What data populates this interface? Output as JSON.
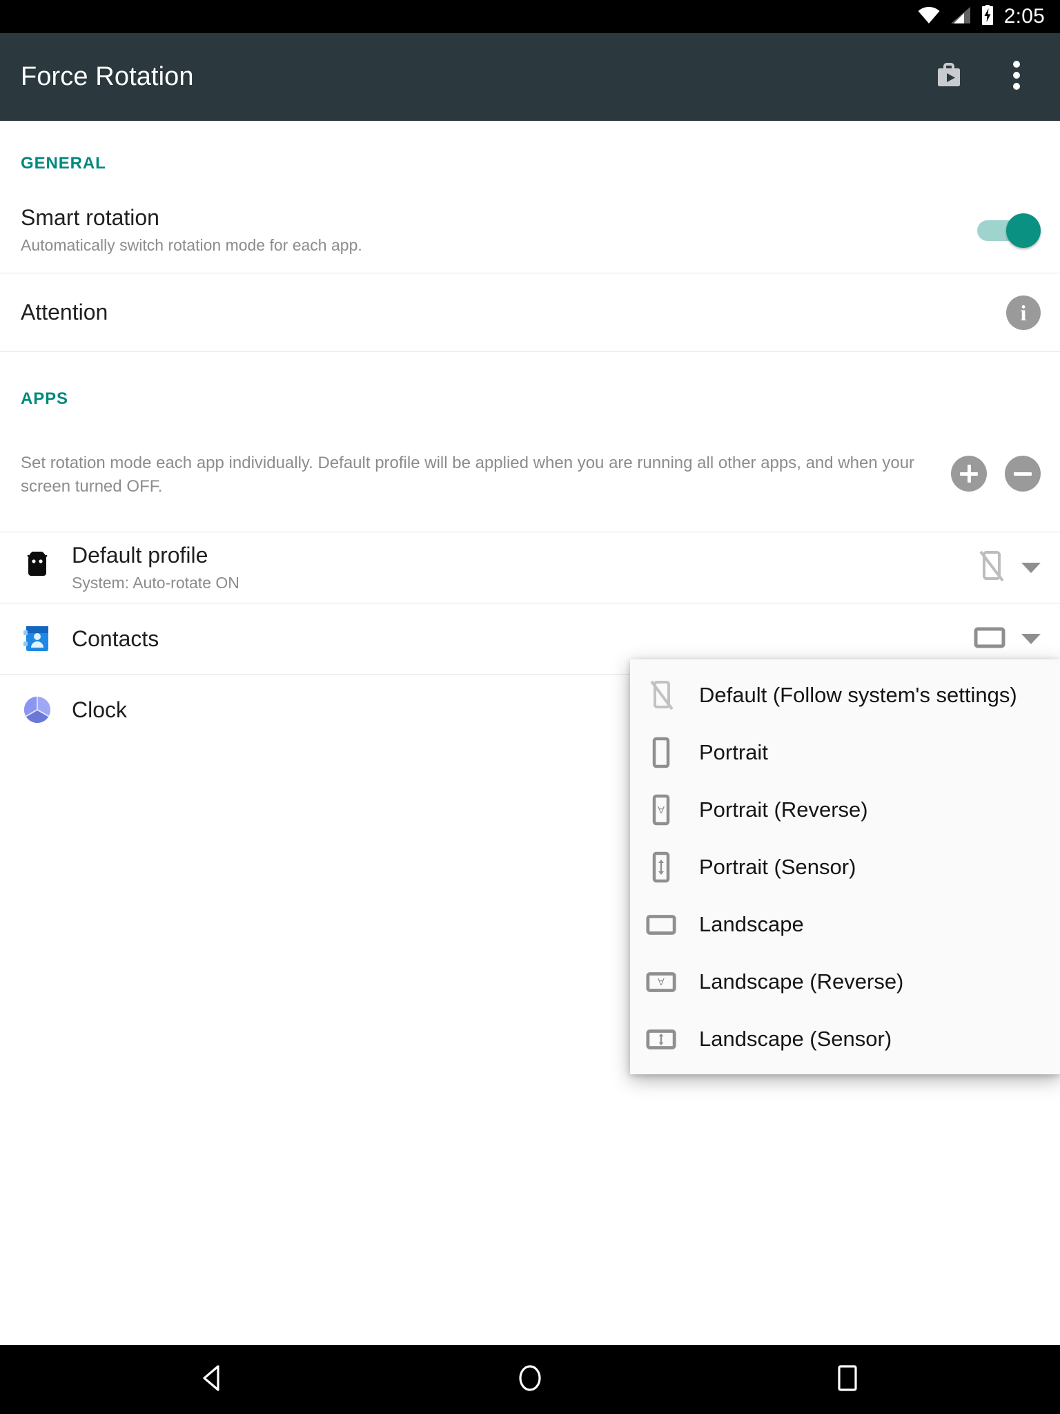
{
  "status_bar": {
    "time": "2:05",
    "icons": [
      "wifi-icon",
      "cell-signal-icon",
      "battery-charging-icon"
    ]
  },
  "app_bar": {
    "title": "Force Rotation",
    "actions": [
      {
        "name": "play-store-icon",
        "label": "Play Store"
      },
      {
        "name": "overflow-menu-icon",
        "label": "More options"
      }
    ]
  },
  "sections": {
    "general": {
      "header": "GENERAL",
      "smart_rotation": {
        "title": "Smart rotation",
        "subtitle": "Automatically switch rotation mode for each app.",
        "toggle_state": "on",
        "toggle_on_color": "#0a9182",
        "toggle_track_color": "#9fd4ce"
      },
      "attention": {
        "title": "Attention",
        "badge": "i"
      }
    },
    "apps": {
      "header": "APPS",
      "description": "Set rotation mode each app individually. Default profile will be applied when you are running all other apps, and when your screen turned OFF.",
      "add_label": "+",
      "remove_label": "−",
      "items": [
        {
          "name": "default-profile",
          "title": "Default profile",
          "subtitle": "System: Auto-rotate ON",
          "icon": "android-robot-icon",
          "mode_icon": "phone-rotation-off-icon",
          "has_caret": true
        },
        {
          "name": "contacts",
          "title": "Contacts",
          "subtitle": "",
          "icon": "contacts-icon",
          "mode_icon": "landscape-icon",
          "has_caret": true
        },
        {
          "name": "clock",
          "title": "Clock",
          "subtitle": "",
          "icon": "clock-icon",
          "mode_icon": "",
          "has_caret": false
        }
      ]
    }
  },
  "dropdown": {
    "open": true,
    "owner": "clock",
    "items": [
      {
        "label": "Default (Follow system's settings)",
        "icon": "phone-rotation-off-icon"
      },
      {
        "label": "Portrait",
        "icon": "portrait-icon"
      },
      {
        "label": "Portrait (Reverse)",
        "icon": "portrait-reverse-icon"
      },
      {
        "label": "Portrait (Sensor)",
        "icon": "portrait-sensor-icon"
      },
      {
        "label": "Landscape",
        "icon": "landscape-icon"
      },
      {
        "label": "Landscape (Reverse)",
        "icon": "landscape-reverse-icon"
      },
      {
        "label": "Landscape (Sensor)",
        "icon": "landscape-sensor-icon"
      }
    ]
  },
  "nav_bar": {
    "buttons": [
      {
        "name": "back-button",
        "icon": "back-triangle-icon"
      },
      {
        "name": "home-button",
        "icon": "home-circle-icon"
      },
      {
        "name": "recents-button",
        "icon": "recents-square-icon"
      }
    ]
  },
  "theme": {
    "accent": "#00897b",
    "app_bar_bg": "#2b383e",
    "status_bar_bg": "#000000",
    "surface": "#ffffff",
    "divider": "#e4e4e4"
  }
}
